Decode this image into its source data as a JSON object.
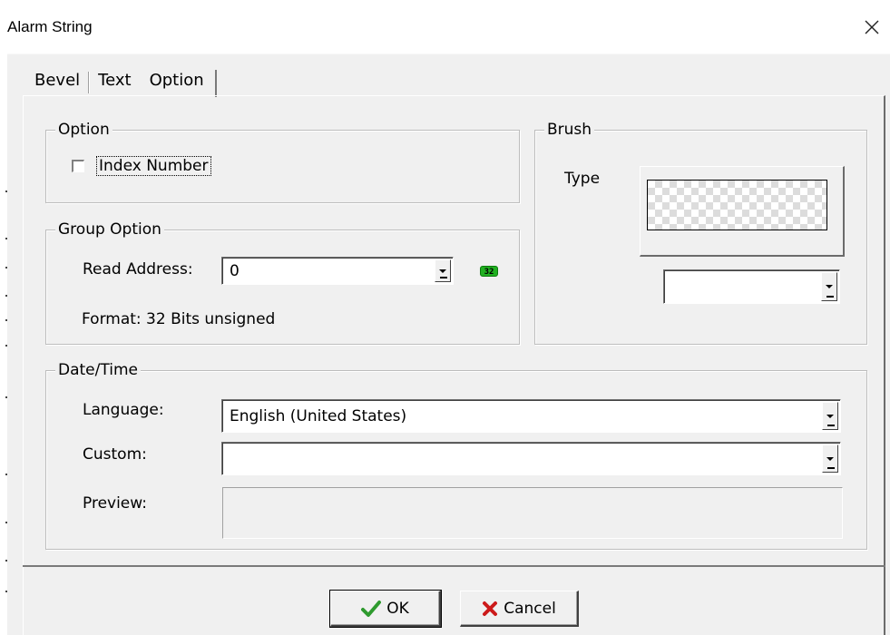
{
  "window": {
    "title": "Alarm String",
    "close_icon": "close-icon"
  },
  "tabs": [
    {
      "label": "Bevel"
    },
    {
      "label": "Text"
    },
    {
      "label": "Option",
      "active": true
    }
  ],
  "option_group": {
    "legend": "Option",
    "index_number": {
      "label": "Index Number",
      "checked": false
    }
  },
  "brush_group": {
    "legend": "Brush",
    "type_label": "Type",
    "pattern_icon": "checkerboard-pattern",
    "select_value": ""
  },
  "group_option": {
    "legend": "Group Option",
    "read_address_label": "Read Address:",
    "read_address_value": "0",
    "badge": "32",
    "format_text": "Format: 32 Bits unsigned"
  },
  "datetime": {
    "legend": "Date/Time",
    "language_label": "Language:",
    "language_value": "English (United States)",
    "custom_label": "Custom:",
    "custom_value": "",
    "preview_label": "Preview:",
    "preview_value": ""
  },
  "buttons": {
    "ok_label": "OK",
    "cancel_label": "Cancel",
    "ok_icon": "checkmark-icon",
    "cancel_icon": "x-icon",
    "ok_icon_color": "#2e9a2e",
    "cancel_icon_color": "#cc1a1a"
  }
}
